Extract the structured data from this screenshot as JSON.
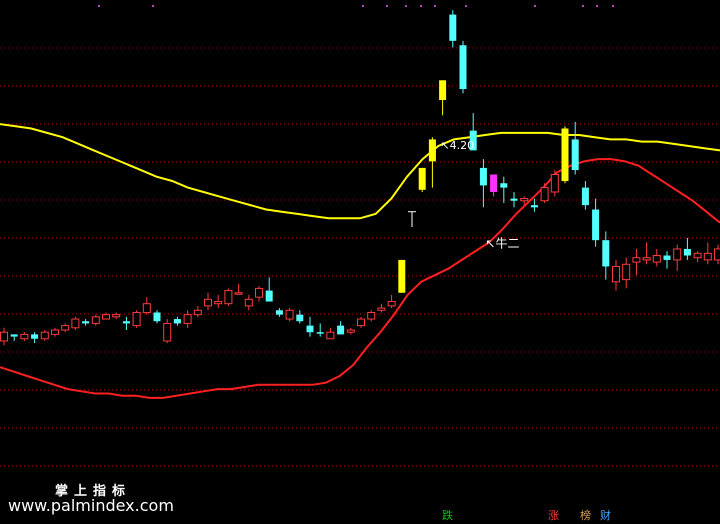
{
  "watermark": {
    "title": "掌上指标",
    "url": "www.palmindex.com"
  },
  "badges": [
    {
      "label": "跌",
      "color": "#00c800"
    },
    {
      "label": "涨",
      "color": "#ff3b3b"
    },
    {
      "label": "榜",
      "color": "#d7a05a"
    },
    {
      "label": "财",
      "color": "#4aa3ff"
    }
  ],
  "colors": {
    "up": "#ff3b3b",
    "down": "#54ffff",
    "limit_up": "#ffff00",
    "special": "#ff30ff",
    "ma_long": "#ffff00",
    "ma_short": "#ff2020",
    "grid": "#b00000",
    "text": "#ffffff"
  },
  "chart_data": {
    "type": "candlestick",
    "ylim": [
      0,
      100
    ],
    "grid": true,
    "annotations": [
      {
        "text": "4.20",
        "at_index": 42,
        "kind": "high"
      },
      {
        "text": "牛二",
        "at_index": 47,
        "kind": "signal"
      }
    ],
    "candles": [
      {
        "o": 62,
        "h": 64,
        "l": 56,
        "c": 58,
        "kind": "up"
      },
      {
        "o": 60,
        "h": 61,
        "l": 58,
        "c": 61,
        "kind": "down"
      },
      {
        "o": 61,
        "h": 62,
        "l": 58,
        "c": 59,
        "kind": "up"
      },
      {
        "o": 61,
        "h": 62,
        "l": 57,
        "c": 59,
        "kind": "down"
      },
      {
        "o": 59,
        "h": 63,
        "l": 58,
        "c": 62,
        "kind": "up"
      },
      {
        "o": 61,
        "h": 64,
        "l": 60,
        "c": 63,
        "kind": "up"
      },
      {
        "o": 63,
        "h": 66,
        "l": 62,
        "c": 65,
        "kind": "up"
      },
      {
        "o": 64,
        "h": 69,
        "l": 63,
        "c": 68,
        "kind": "up"
      },
      {
        "o": 67,
        "h": 68,
        "l": 65,
        "c": 66,
        "kind": "down"
      },
      {
        "o": 66,
        "h": 70,
        "l": 65,
        "c": 69,
        "kind": "up"
      },
      {
        "o": 68,
        "h": 71,
        "l": 68,
        "c": 70,
        "kind": "up"
      },
      {
        "o": 69,
        "h": 71,
        "l": 68,
        "c": 70,
        "kind": "up"
      },
      {
        "o": 67,
        "h": 69,
        "l": 63,
        "c": 66,
        "kind": "down"
      },
      {
        "o": 65,
        "h": 72,
        "l": 64,
        "c": 71,
        "kind": "up"
      },
      {
        "o": 71,
        "h": 78,
        "l": 70,
        "c": 75,
        "kind": "up"
      },
      {
        "o": 71,
        "h": 72,
        "l": 66,
        "c": 67,
        "kind": "down"
      },
      {
        "o": 58,
        "h": 68,
        "l": 57,
        "c": 66,
        "kind": "up"
      },
      {
        "o": 68,
        "h": 69,
        "l": 65,
        "c": 66,
        "kind": "down"
      },
      {
        "o": 66,
        "h": 72,
        "l": 64,
        "c": 70,
        "kind": "up"
      },
      {
        "o": 70,
        "h": 74,
        "l": 69,
        "c": 72,
        "kind": "up"
      },
      {
        "o": 74,
        "h": 80,
        "l": 72,
        "c": 77,
        "kind": "up"
      },
      {
        "o": 75,
        "h": 79,
        "l": 73,
        "c": 76,
        "kind": "up"
      },
      {
        "o": 75,
        "h": 82,
        "l": 74,
        "c": 81,
        "kind": "up"
      },
      {
        "o": 80,
        "h": 84,
        "l": 79,
        "c": 80,
        "kind": "up"
      },
      {
        "o": 74,
        "h": 79,
        "l": 72,
        "c": 77,
        "kind": "up"
      },
      {
        "o": 78,
        "h": 83,
        "l": 76,
        "c": 82,
        "kind": "up"
      },
      {
        "o": 81,
        "h": 87,
        "l": 80,
        "c": 76,
        "kind": "down"
      },
      {
        "o": 72,
        "h": 73,
        "l": 69,
        "c": 70,
        "kind": "down"
      },
      {
        "o": 68,
        "h": 73,
        "l": 67,
        "c": 72,
        "kind": "up"
      },
      {
        "o": 70,
        "h": 72,
        "l": 66,
        "c": 67,
        "kind": "down"
      },
      {
        "o": 65,
        "h": 69,
        "l": 60,
        "c": 62,
        "kind": "down"
      },
      {
        "o": 62,
        "h": 66,
        "l": 60,
        "c": 62,
        "kind": "down"
      },
      {
        "o": 59,
        "h": 64,
        "l": 59,
        "c": 62,
        "kind": "up"
      },
      {
        "o": 65,
        "h": 67,
        "l": 63,
        "c": 61,
        "kind": "down"
      },
      {
        "o": 62,
        "h": 64,
        "l": 61,
        "c": 63,
        "kind": "up"
      },
      {
        "o": 65,
        "h": 69,
        "l": 64,
        "c": 68,
        "kind": "up"
      },
      {
        "o": 68,
        "h": 72,
        "l": 67,
        "c": 71,
        "kind": "up"
      },
      {
        "o": 72,
        "h": 75,
        "l": 71,
        "c": 73,
        "kind": "up"
      },
      {
        "o": 74,
        "h": 79,
        "l": 73,
        "c": 76,
        "kind": "up"
      },
      {
        "o": 80,
        "h": 95,
        "l": 80,
        "c": 95,
        "kind": "limit"
      },
      {
        "o": 117,
        "h": 117,
        "l": 110,
        "c": 117,
        "kind": "cross"
      },
      {
        "o": 127,
        "h": 128,
        "l": 126,
        "c": 137,
        "kind": "limit"
      },
      {
        "o": 140,
        "h": 151,
        "l": 128,
        "c": 150,
        "kind": "limit"
      },
      {
        "o": 168,
        "h": 172,
        "l": 161,
        "c": 177,
        "kind": "limit"
      },
      {
        "o": 207,
        "h": 209,
        "l": 192,
        "c": 195,
        "kind": "down"
      },
      {
        "o": 193,
        "h": 195,
        "l": 171,
        "c": 173,
        "kind": "down"
      },
      {
        "o": 154,
        "h": 162,
        "l": 146,
        "c": 145,
        "kind": "down"
      },
      {
        "o": 137,
        "h": 141,
        "l": 119,
        "c": 129,
        "kind": "down"
      },
      {
        "o": 134,
        "h": 133,
        "l": 124,
        "c": 126,
        "kind": "special"
      },
      {
        "o": 130,
        "h": 133,
        "l": 121,
        "c": 128,
        "kind": "down"
      },
      {
        "o": 122,
        "h": 126,
        "l": 119,
        "c": 123,
        "kind": "down"
      },
      {
        "o": 123,
        "h": 124,
        "l": 120,
        "c": 122,
        "kind": "up"
      },
      {
        "o": 120,
        "h": 123,
        "l": 117,
        "c": 119,
        "kind": "down"
      },
      {
        "o": 122,
        "h": 130,
        "l": 121,
        "c": 128,
        "kind": "up"
      },
      {
        "o": 126,
        "h": 136,
        "l": 124,
        "c": 134,
        "kind": "up"
      },
      {
        "o": 131,
        "h": 156,
        "l": 130,
        "c": 155,
        "kind": "limit"
      },
      {
        "o": 150,
        "h": 158,
        "l": 134,
        "c": 136,
        "kind": "down"
      },
      {
        "o": 128,
        "h": 131,
        "l": 118,
        "c": 120,
        "kind": "down"
      },
      {
        "o": 118,
        "h": 123,
        "l": 101,
        "c": 104,
        "kind": "down"
      },
      {
        "o": 104,
        "h": 108,
        "l": 86,
        "c": 92,
        "kind": "down"
      },
      {
        "o": 92,
        "h": 95,
        "l": 81,
        "c": 85,
        "kind": "up"
      },
      {
        "o": 86,
        "h": 96,
        "l": 82,
        "c": 93,
        "kind": "up"
      },
      {
        "o": 94,
        "h": 100,
        "l": 88,
        "c": 96,
        "kind": "up"
      },
      {
        "o": 96,
        "h": 103,
        "l": 93,
        "c": 95,
        "kind": "up"
      },
      {
        "o": 97,
        "h": 100,
        "l": 92,
        "c": 94,
        "kind": "up"
      },
      {
        "o": 97,
        "h": 99,
        "l": 91,
        "c": 95,
        "kind": "down"
      },
      {
        "o": 95,
        "h": 102,
        "l": 90,
        "c": 100,
        "kind": "up"
      },
      {
        "o": 100,
        "h": 105,
        "l": 95,
        "c": 97,
        "kind": "down"
      },
      {
        "o": 96,
        "h": 99,
        "l": 94,
        "c": 98,
        "kind": "up"
      },
      {
        "o": 98,
        "h": 103,
        "l": 93,
        "c": 95,
        "kind": "up"
      },
      {
        "o": 95,
        "h": 102,
        "l": 93,
        "c": 100,
        "kind": "up"
      },
      {
        "o": 100,
        "h": 103,
        "l": 96,
        "c": 97,
        "kind": "down"
      }
    ],
    "ma_long": [
      157,
      156,
      155,
      153,
      151,
      148,
      145,
      142,
      139,
      136,
      133,
      131,
      128,
      126,
      124,
      122,
      120,
      118,
      117,
      116,
      115,
      114,
      114,
      114,
      116,
      123,
      133,
      141,
      147,
      150,
      151,
      152,
      153,
      153,
      153,
      153,
      152,
      152,
      151,
      150,
      150,
      149,
      149,
      148,
      147,
      146,
      145
    ],
    "ma_short": [
      46,
      44,
      42,
      40,
      38,
      36,
      35,
      34,
      34,
      33,
      33,
      32,
      32,
      33,
      34,
      35,
      36,
      36,
      37,
      38,
      38,
      38,
      38,
      38,
      39,
      42,
      47,
      55,
      62,
      70,
      79,
      85,
      88,
      91,
      95,
      99,
      103,
      109,
      116,
      122,
      128,
      135,
      138,
      140,
      141,
      141,
      140,
      138,
      134,
      130,
      126,
      122,
      117,
      112
    ]
  }
}
